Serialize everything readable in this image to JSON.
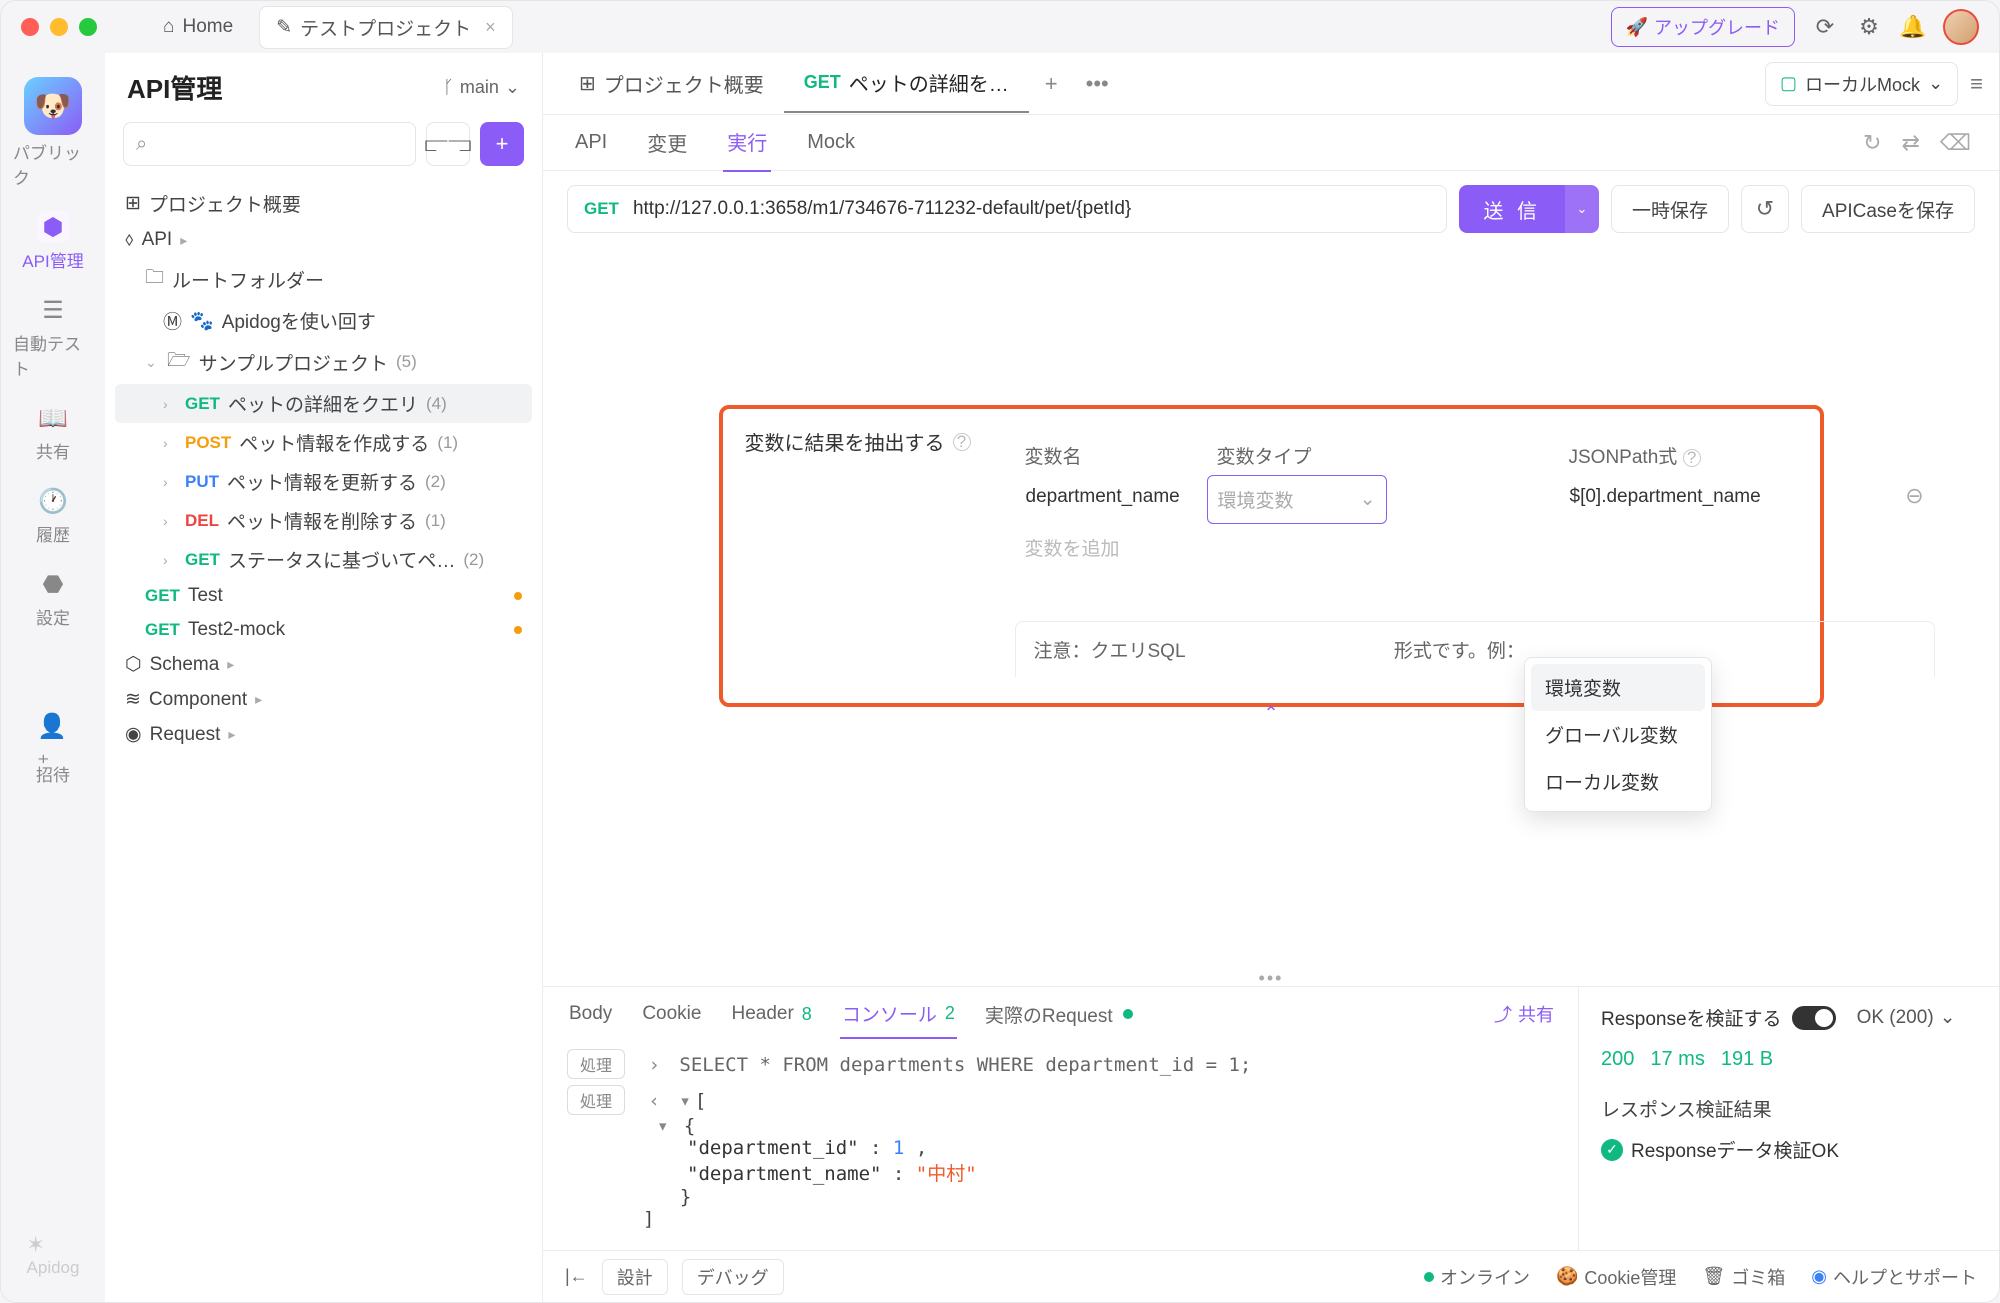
{
  "titlebar": {
    "home": "Home",
    "project_tab": "テストプロジェクト",
    "upgrade": "アップグレード"
  },
  "leftbar": {
    "public": "パブリック",
    "api": "API管理",
    "autotest": "自動テスト",
    "share": "共有",
    "history": "履歴",
    "settings": "設定",
    "invite": "招待",
    "logo": "Apidog"
  },
  "sidebar": {
    "title": "API管理",
    "branch": "main",
    "project_overview": "プロジェクト概要",
    "api_root": "API",
    "root_folder": "ルートフォルダー",
    "apidog_reuse": "Apidogを使い回す",
    "sample_project": "サンプルプロジェクト",
    "sample_count": "(5)",
    "r1": {
      "m": "GET",
      "t": "ペットの詳細をクエリ",
      "c": "(4)"
    },
    "r2": {
      "m": "POST",
      "t": "ペット情報を作成する",
      "c": "(1)"
    },
    "r3": {
      "m": "PUT",
      "t": "ペット情報を更新する",
      "c": "(2)"
    },
    "r4": {
      "m": "DEL",
      "t": "ペット情報を削除する",
      "c": "(1)"
    },
    "r5": {
      "m": "GET",
      "t": "ステータスに基づいてペ…",
      "c": "(2)"
    },
    "r6": {
      "m": "GET",
      "t": "Test"
    },
    "r7": {
      "m": "GET",
      "t": "Test2-mock"
    },
    "schema": "Schema",
    "component": "Component",
    "request": "Request"
  },
  "mtabs": {
    "overview": "プロジェクト概要",
    "active": "ペットの詳細を…",
    "env": "ローカルMock"
  },
  "subtabs": {
    "api": "API",
    "change": "変更",
    "run": "実行",
    "mock": "Mock"
  },
  "urlbar": {
    "method": "GET",
    "url": "http://127.0.0.1:3658/m1/734676-711232-default/pet/{petId}",
    "send": "送 信",
    "save_temp": "一時保存",
    "save_case": "APICaseを保存"
  },
  "var_extract": {
    "title": "変数に結果を抽出する",
    "head_name": "変数名",
    "head_type": "変数タイプ",
    "head_path": "JSONPath式",
    "name_val": "department_name",
    "type_ph": "環境変数",
    "path_val": "$[0].department_name",
    "add_ph": "変数を追加",
    "note": "注意：クエリSQL　　　　　　　　　　　形式です。例：",
    "dd1": "環境変数",
    "dd2": "グローバル変数",
    "dd3": "ローカル変数"
  },
  "resp": {
    "body": "Body",
    "cookie": "Cookie",
    "header": "Header",
    "header_n": "8",
    "console": "コンソール",
    "console_n": "2",
    "actual": "実際のRequest",
    "share": "共有",
    "chip": "処理",
    "sql": "SELECT * FROM departments WHERE department_id = 1;",
    "json_k1": "\"department_id\"",
    "json_v1": "1",
    "json_k2": "\"department_name\"",
    "json_v2": "\"中村\"",
    "verify_title": "Responseを検証する",
    "ok_status": "OK (200)",
    "s1": "200",
    "s2": "17 ms",
    "s3": "191 B",
    "result_h": "レスポンス検証結果",
    "ok_text": "Responseデータ検証OK"
  },
  "footer": {
    "design": "設計",
    "debug": "デバッグ",
    "online": "オンライン",
    "cookie": "Cookie管理",
    "trash": "ゴミ箱",
    "help": "ヘルプとサポート"
  }
}
